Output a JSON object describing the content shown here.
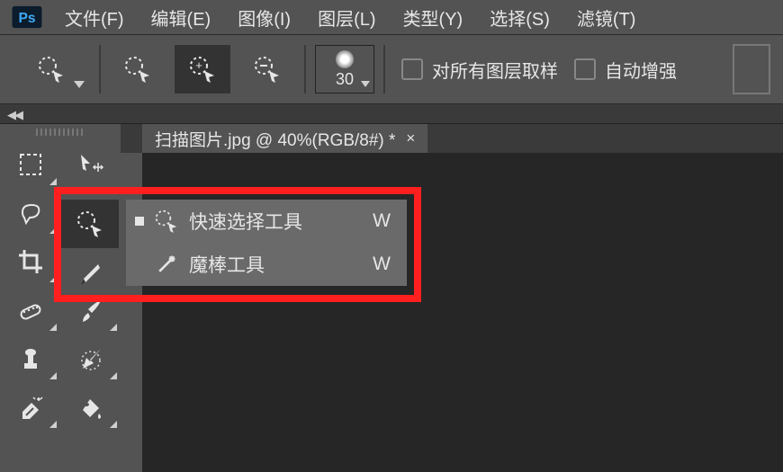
{
  "menu": {
    "items": [
      "文件(F)",
      "编辑(E)",
      "图像(I)",
      "图层(L)",
      "类型(Y)",
      "选择(S)",
      "滤镜(T)"
    ]
  },
  "options": {
    "brush_size": "30",
    "checks": [
      {
        "label": "对所有图层取样"
      },
      {
        "label": "自动增强"
      }
    ]
  },
  "tab": {
    "title": "扫描图片.jpg @ 40%(RGB/8#) *",
    "close": "×"
  },
  "flyout": {
    "items": [
      {
        "label": "快速选择工具",
        "key": "W",
        "active": true
      },
      {
        "label": "魔棒工具",
        "key": "W",
        "active": false
      }
    ]
  }
}
